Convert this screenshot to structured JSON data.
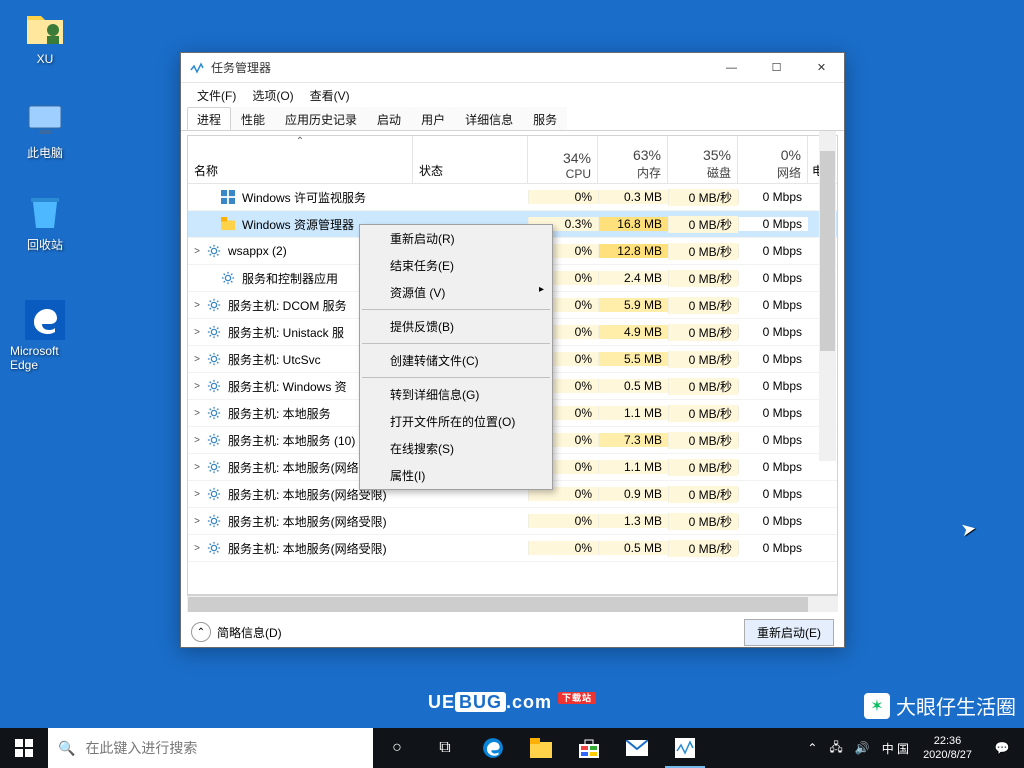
{
  "desktop": {
    "icons": [
      {
        "label": "XU"
      },
      {
        "label": "此电脑"
      },
      {
        "label": "回收站"
      },
      {
        "label": "Microsoft Edge"
      }
    ]
  },
  "taskManager": {
    "title": "任务管理器",
    "menu": {
      "file": "文件(F)",
      "options": "选项(O)",
      "view": "查看(V)"
    },
    "tabs": [
      "进程",
      "性能",
      "应用历史记录",
      "启动",
      "用户",
      "详细信息",
      "服务"
    ],
    "activeTab": 0,
    "columns": {
      "name": "名称",
      "status": "状态",
      "cpu": {
        "pct": "34%",
        "label": "CPU"
      },
      "mem": {
        "pct": "63%",
        "label": "内存"
      },
      "disk": {
        "pct": "35%",
        "label": "磁盘"
      },
      "net": {
        "pct": "0%",
        "label": "网络"
      },
      "extra": "电"
    },
    "rows": [
      {
        "exp": "",
        "name": "Windows 许可监视服务",
        "cpu": "0%",
        "mem": "0.3 MB",
        "disk": "0 MB/秒",
        "net": "0 Mbps",
        "iconType": "win",
        "indent": 1
      },
      {
        "exp": "",
        "name": "Windows 资源管理器",
        "cpu": "0.3%",
        "mem": "16.8 MB",
        "disk": "0 MB/秒",
        "net": "0 Mbps",
        "iconType": "folder",
        "indent": 1,
        "selected": true
      },
      {
        "exp": ">",
        "name": "wsappx (2)",
        "cpu": "0%",
        "mem": "12.8 MB",
        "disk": "0 MB/秒",
        "net": "0 Mbps",
        "iconType": "gear",
        "indent": 0
      },
      {
        "exp": "",
        "name": "服务和控制器应用",
        "cpu": "0%",
        "mem": "2.4 MB",
        "disk": "0 MB/秒",
        "net": "0 Mbps",
        "iconType": "gear",
        "indent": 1
      },
      {
        "exp": ">",
        "name": "服务主机: DCOM 服务",
        "cpu": "0%",
        "mem": "5.9 MB",
        "disk": "0 MB/秒",
        "net": "0 Mbps",
        "iconType": "gear",
        "indent": 0
      },
      {
        "exp": ">",
        "name": "服务主机: Unistack 服",
        "cpu": "0%",
        "mem": "4.9 MB",
        "disk": "0 MB/秒",
        "net": "0 Mbps",
        "iconType": "gear",
        "indent": 0
      },
      {
        "exp": ">",
        "name": "服务主机: UtcSvc",
        "cpu": "0%",
        "mem": "5.5 MB",
        "disk": "0 MB/秒",
        "net": "0 Mbps",
        "iconType": "gear",
        "indent": 0
      },
      {
        "exp": ">",
        "name": "服务主机: Windows 资",
        "cpu": "0%",
        "mem": "0.5 MB",
        "disk": "0 MB/秒",
        "net": "0 Mbps",
        "iconType": "gear",
        "indent": 0
      },
      {
        "exp": ">",
        "name": "服务主机: 本地服务",
        "cpu": "0%",
        "mem": "1.1 MB",
        "disk": "0 MB/秒",
        "net": "0 Mbps",
        "iconType": "gear",
        "indent": 0
      },
      {
        "exp": ">",
        "name": "服务主机: 本地服务 (10)",
        "cpu": "0%",
        "mem": "7.3 MB",
        "disk": "0 MB/秒",
        "net": "0 Mbps",
        "iconType": "gear",
        "indent": 0
      },
      {
        "exp": ">",
        "name": "服务主机: 本地服务(网络受限)",
        "cpu": "0%",
        "mem": "1.1 MB",
        "disk": "0 MB/秒",
        "net": "0 Mbps",
        "iconType": "gear",
        "indent": 0
      },
      {
        "exp": ">",
        "name": "服务主机: 本地服务(网络受限)",
        "cpu": "0%",
        "mem": "0.9 MB",
        "disk": "0 MB/秒",
        "net": "0 Mbps",
        "iconType": "gear",
        "indent": 0
      },
      {
        "exp": ">",
        "name": "服务主机: 本地服务(网络受限)",
        "cpu": "0%",
        "mem": "1.3 MB",
        "disk": "0 MB/秒",
        "net": "0 Mbps",
        "iconType": "gear",
        "indent": 0
      },
      {
        "exp": ">",
        "name": "服务主机: 本地服务(网络受限)",
        "cpu": "0%",
        "mem": "0.5 MB",
        "disk": "0 MB/秒",
        "net": "0 Mbps",
        "iconType": "gear",
        "indent": 0
      }
    ],
    "footer": {
      "less": "简略信息(D)",
      "restart": "重新启动(E)"
    }
  },
  "contextMenu": {
    "items": [
      {
        "label": "重新启动(R)"
      },
      {
        "label": "结束任务(E)"
      },
      {
        "label": "资源值 (V)",
        "sub": true
      },
      {
        "sep": true
      },
      {
        "label": "提供反馈(B)"
      },
      {
        "sep": true
      },
      {
        "label": "创建转储文件(C)"
      },
      {
        "sep": true
      },
      {
        "label": "转到详细信息(G)"
      },
      {
        "label": "打开文件所在的位置(O)"
      },
      {
        "label": "在线搜索(S)"
      },
      {
        "label": "属性(I)"
      }
    ]
  },
  "taskbar": {
    "searchPlaceholder": "在此键入进行搜索",
    "ime": "中 国",
    "time": "22:36",
    "date": "2020/8/27"
  },
  "watermarks": {
    "center": "UE",
    "center2": "BUG",
    "center3": ".com",
    "centerSub": "下载站",
    "right": "大眼仔生活圈"
  }
}
